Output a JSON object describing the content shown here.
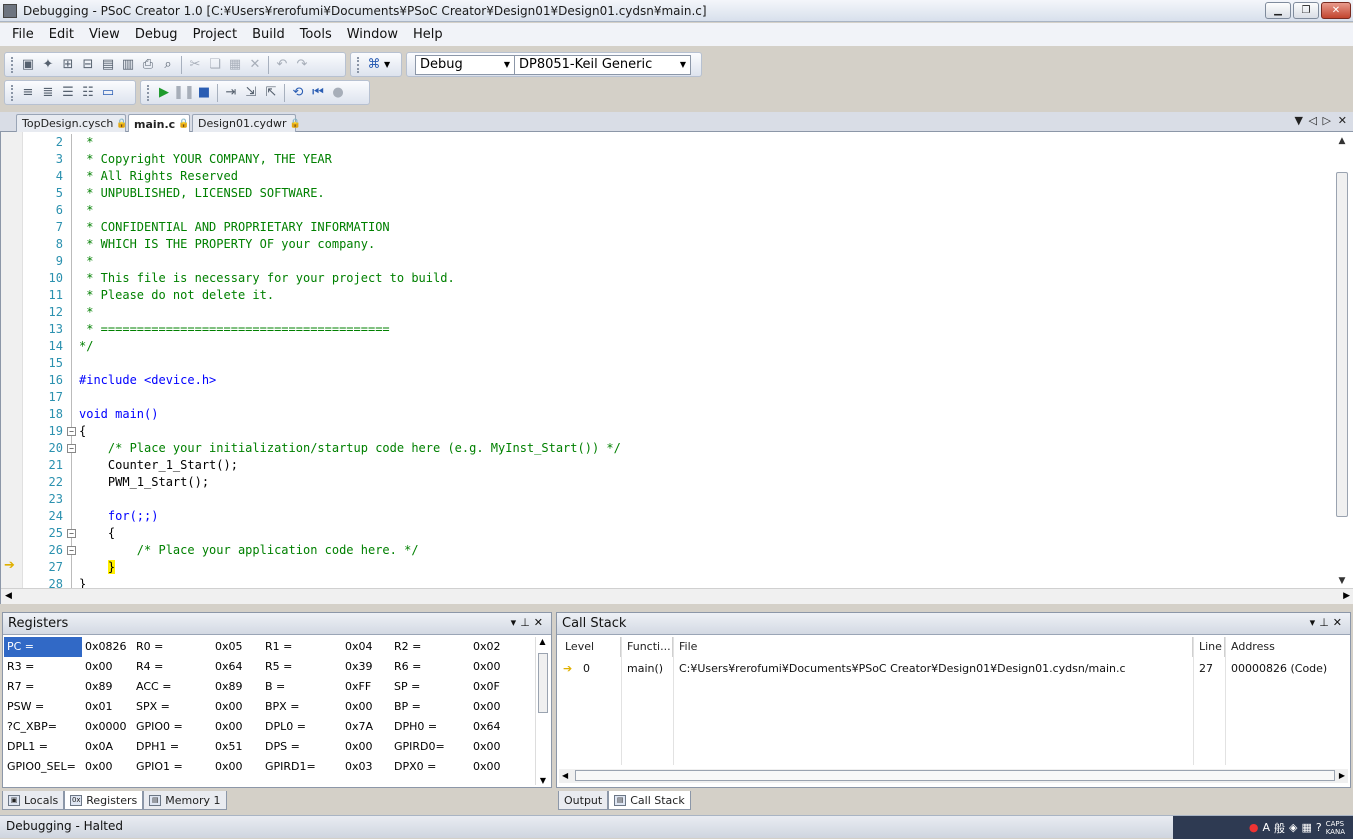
{
  "window": {
    "title": "Debugging - PSoC Creator 1.0  [C:¥Users¥rerofumi¥Documents¥PSoC Creator¥Design01¥Design01.cydsn¥main.c]"
  },
  "menu": [
    "File",
    "Edit",
    "View",
    "Debug",
    "Project",
    "Build",
    "Tools",
    "Window",
    "Help"
  ],
  "toolbar": {
    "config": "Debug",
    "target": "DP8051-Keil Generic"
  },
  "tabs": [
    {
      "label": "TopDesign.cysch",
      "active": false
    },
    {
      "label": "main.c",
      "active": true
    },
    {
      "label": "Design01.cydwr",
      "active": false
    }
  ],
  "code": [
    {
      "n": "2",
      "t": " *",
      "c": "comment"
    },
    {
      "n": "3",
      "t": " * Copyright YOUR COMPANY, THE YEAR",
      "c": "comment"
    },
    {
      "n": "4",
      "t": " * All Rights Reserved",
      "c": "comment"
    },
    {
      "n": "5",
      "t": " * UNPUBLISHED, LICENSED SOFTWARE.",
      "c": "comment"
    },
    {
      "n": "6",
      "t": " *",
      "c": "comment"
    },
    {
      "n": "7",
      "t": " * CONFIDENTIAL AND PROPRIETARY INFORMATION",
      "c": "comment"
    },
    {
      "n": "8",
      "t": " * WHICH IS THE PROPERTY OF your company.",
      "c": "comment"
    },
    {
      "n": "9",
      "t": " *",
      "c": "comment"
    },
    {
      "n": "10",
      "t": " * This file is necessary for your project to build.",
      "c": "comment"
    },
    {
      "n": "11",
      "t": " * Please do not delete it.",
      "c": "comment"
    },
    {
      "n": "12",
      "t": " *",
      "c": "comment"
    },
    {
      "n": "13",
      "t": " * ========================================",
      "c": "comment"
    },
    {
      "n": "14",
      "t": "*/",
      "c": "comment"
    },
    {
      "n": "15",
      "t": "",
      "c": "normal"
    },
    {
      "n": "16",
      "t": "#include <device.h>",
      "c": "pre"
    },
    {
      "n": "17",
      "t": "",
      "c": "normal"
    },
    {
      "n": "18",
      "t": "void main()",
      "c": "kw"
    },
    {
      "n": "19",
      "t": "{",
      "c": "normal"
    },
    {
      "n": "20",
      "t": "    /* Place your initialization/startup code here (e.g. MyInst_Start()) */",
      "c": "comment"
    },
    {
      "n": "21",
      "t": "    Counter_1_Start();",
      "c": "normal"
    },
    {
      "n": "22",
      "t": "    PWM_1_Start();",
      "c": "normal"
    },
    {
      "n": "23",
      "t": "",
      "c": "normal"
    },
    {
      "n": "24",
      "t": "    for(;;)",
      "c": "kw"
    },
    {
      "n": "25",
      "t": "    {",
      "c": "normal"
    },
    {
      "n": "26",
      "t": "        /* Place your application code here. */",
      "c": "comment"
    },
    {
      "n": "27",
      "t": "    }",
      "c": "normal"
    },
    {
      "n": "28",
      "t": "}",
      "c": "normal"
    }
  ],
  "registers": {
    "title": "Registers",
    "rows": [
      [
        [
          "PC  =",
          "0x0826"
        ],
        [
          "R0  =",
          "0x05"
        ],
        [
          "R1  =",
          "0x04"
        ],
        [
          "R2  =",
          "0x02"
        ]
      ],
      [
        [
          "R3  =",
          "0x00"
        ],
        [
          "R4  =",
          "0x64"
        ],
        [
          "R5  =",
          "0x39"
        ],
        [
          "R6  =",
          "0x00"
        ]
      ],
      [
        [
          "R7  =",
          "0x89"
        ],
        [
          "ACC  =",
          "0x89"
        ],
        [
          "B   =",
          "0xFF"
        ],
        [
          "SP  =",
          "0x0F"
        ]
      ],
      [
        [
          "PSW  =",
          "0x01"
        ],
        [
          "SPX  =",
          "0x00"
        ],
        [
          "BPX  =",
          "0x00"
        ],
        [
          "BP  =",
          "0x00"
        ]
      ],
      [
        [
          "?C_XBP=",
          "0x0000"
        ],
        [
          "GPIO0 =",
          "0x00"
        ],
        [
          "DPL0 =",
          "0x7A"
        ],
        [
          "DPH0 =",
          "0x64"
        ]
      ],
      [
        [
          "DPL1 =",
          "0x0A"
        ],
        [
          "DPH1 =",
          "0x51"
        ],
        [
          "DPS  =",
          "0x00"
        ],
        [
          "GPIRD0=",
          "0x00"
        ]
      ],
      [
        [
          "GPIO0_SEL=",
          "0x00"
        ],
        [
          "GPIO1 =",
          "0x00"
        ],
        [
          "GPIRD1=",
          "0x03"
        ],
        [
          "DPX0 =",
          "0x00"
        ]
      ]
    ]
  },
  "callstack": {
    "title": "Call Stack",
    "headers": [
      "Level",
      "Functi...",
      "File",
      "Line",
      "Address"
    ],
    "row": [
      "0",
      "main()",
      "C:¥Users¥rerofumi¥Documents¥PSoC Creator¥Design01¥Design01.cydsn/main.c",
      "27",
      "00000826 (Code)"
    ]
  },
  "bottom_tabs_left": [
    "Locals",
    "Registers",
    "Memory 1"
  ],
  "bottom_tabs_right": [
    "Output",
    "Call Stack"
  ],
  "status": "Debugging - Halted"
}
